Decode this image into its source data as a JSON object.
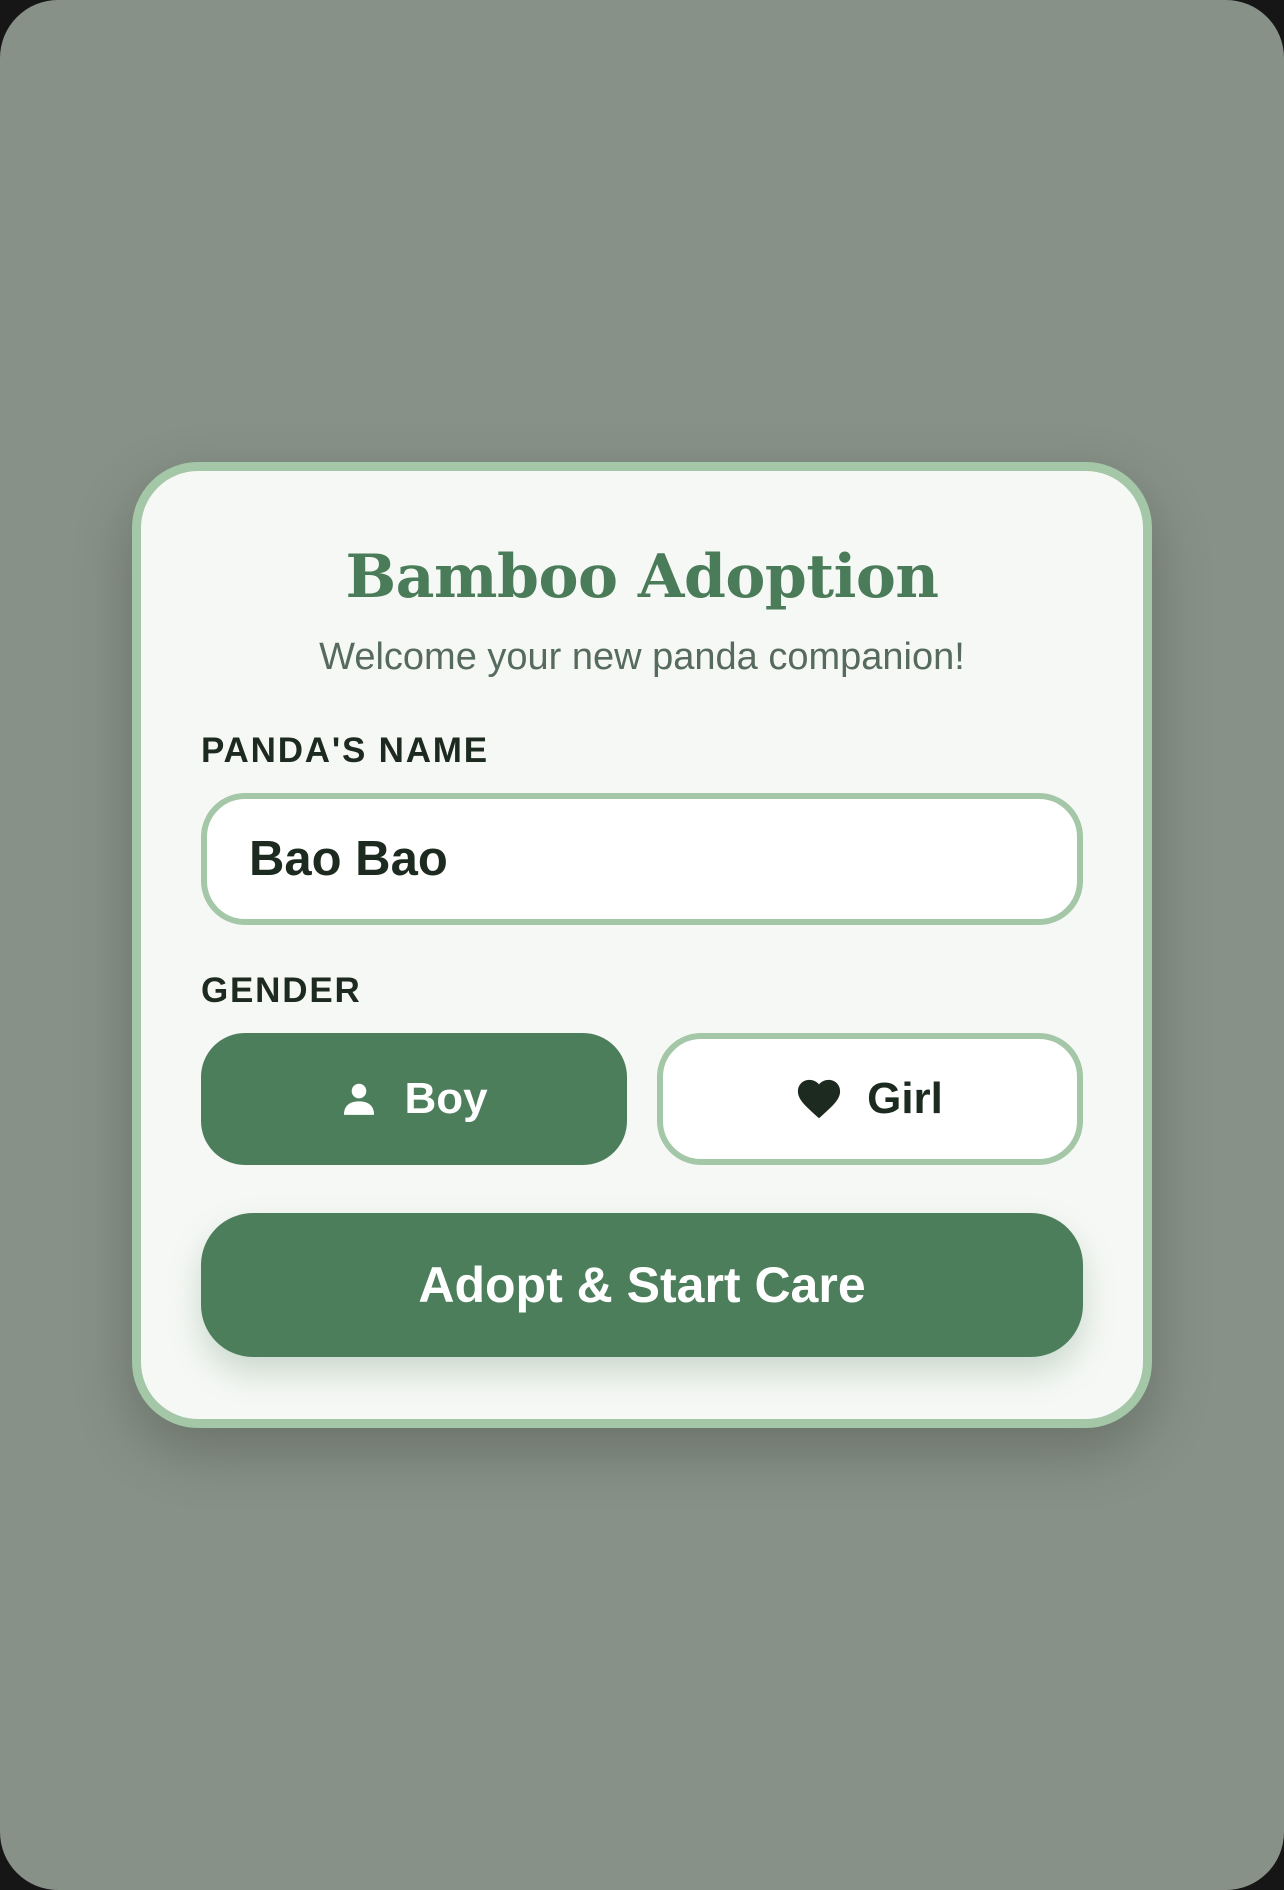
{
  "app": {
    "title": "Bamboo Adoption",
    "subtitle": "Welcome your new panda companion!"
  },
  "form": {
    "name_label": "PANDA'S NAME",
    "name_value": "Bao Bao",
    "gender_label": "GENDER",
    "gender_options": [
      {
        "label": "Boy",
        "icon": "person-icon",
        "selected": true
      },
      {
        "label": "Girl",
        "icon": "heart-icon",
        "selected": false
      }
    ],
    "submit_label": "Adopt & Start Care"
  },
  "colors": {
    "primary": "#4d7e5b",
    "border": "#a3c7a7",
    "backdrop": "#879187",
    "card": "#f6f8f5"
  }
}
